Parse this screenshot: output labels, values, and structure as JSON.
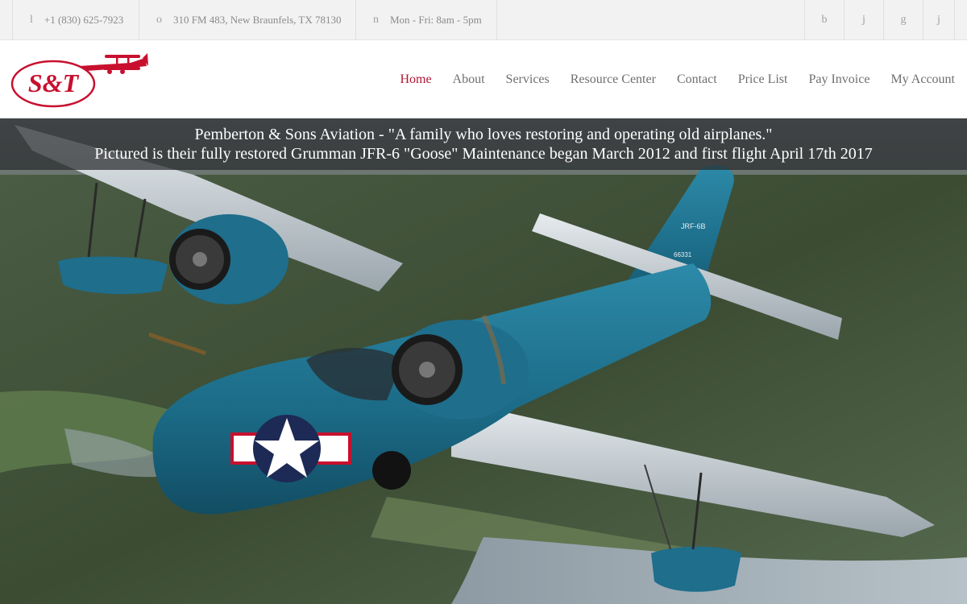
{
  "topbar": {
    "phone": {
      "icon": "phone-icon",
      "glyph": "l",
      "text": "+1 (830) 625-7923"
    },
    "address": {
      "icon": "location-pin-icon",
      "glyph": "o",
      "text": "310 FM 483, New Braunfels, TX 78130"
    },
    "hours": {
      "icon": "clock-icon",
      "glyph": "n",
      "text": "Mon - Fri: 8am - 5pm"
    },
    "social": [
      {
        "icon": "facebook-icon",
        "glyph": "b"
      },
      {
        "icon": "twitter-icon",
        "glyph": "j"
      },
      {
        "icon": "google-plus-icon",
        "glyph": "g"
      },
      {
        "icon": "linkedin-icon",
        "glyph": "j"
      }
    ]
  },
  "header": {
    "logo_text": "S&T",
    "nav": [
      "Home",
      "About",
      "Services",
      "Resource Center",
      "Contact",
      "Price List",
      "Pay Invoice",
      "My Account"
    ],
    "active_nav": "Home"
  },
  "hero": {
    "caption_line1": "Pemberton & Sons Aviation - \"A family who loves restoring and operating old airplanes.\"",
    "caption_line2": "Pictured is their fully restored Grumman JFR-6 \"Goose\" Maintenance began March 2012 and first flight April 17th 2017",
    "tail_code": "JRF-6B",
    "tail_number": "66331",
    "image": "grumman-goose-aircraft-photo"
  },
  "colors": {
    "brand_red": "#b01532",
    "nav_text": "#6f6f6f",
    "topbar_bg": "#f2f2f2",
    "aircraft_blue": "#1f6f8b"
  }
}
